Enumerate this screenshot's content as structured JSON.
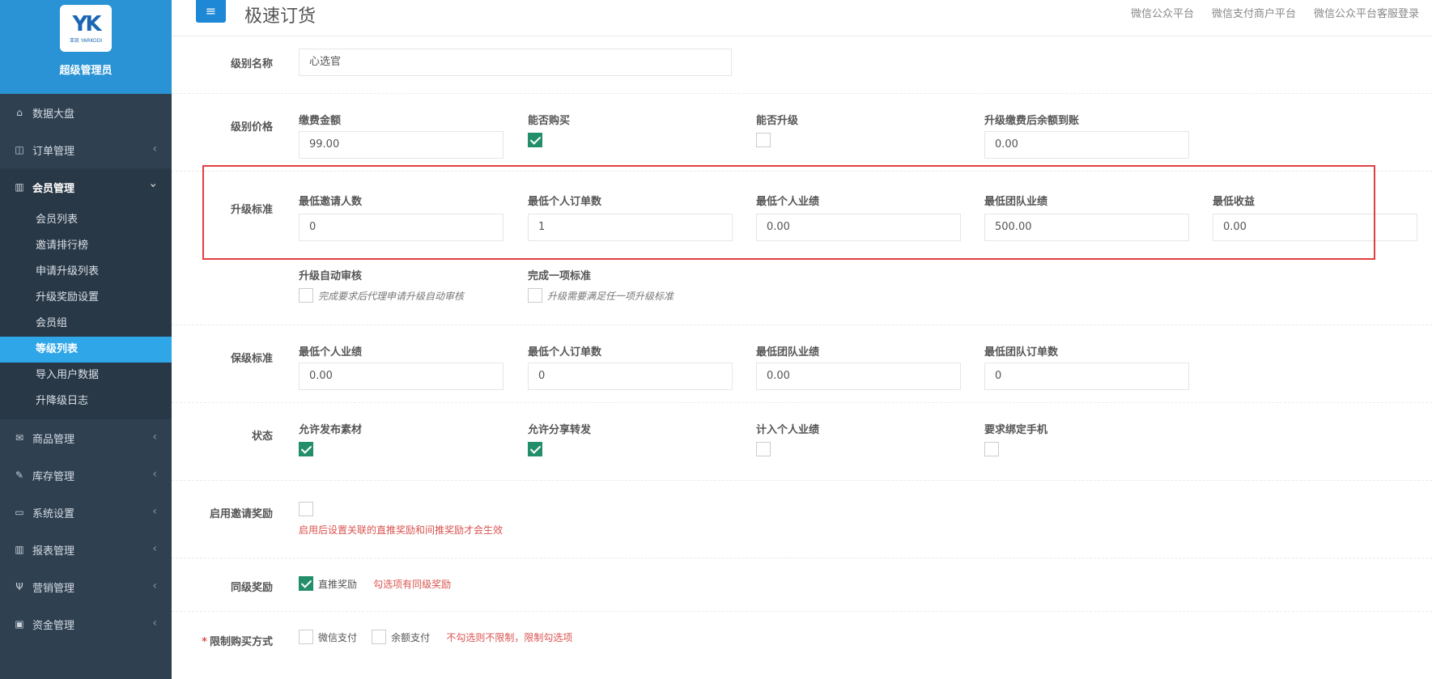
{
  "sidebar": {
    "brand_mark": "YK",
    "brand_sub": "亚凯 YARKODI",
    "brand_name": "超级管理员",
    "items": [
      {
        "label": "数据大盘",
        "icon": "home-icon"
      },
      {
        "label": "订单管理",
        "icon": "columns-icon"
      },
      {
        "label": "会员管理",
        "icon": "bar-chart-icon"
      },
      {
        "label": "商品管理",
        "icon": "envelope-icon"
      },
      {
        "label": "库存管理",
        "icon": "edit-icon"
      },
      {
        "label": "系统设置",
        "icon": "desktop-icon"
      },
      {
        "label": "报表管理",
        "icon": "bar-chart-icon"
      },
      {
        "label": "营销管理",
        "icon": "cutlery-icon"
      },
      {
        "label": "资金管理",
        "icon": "money-icon"
      }
    ],
    "submenu": [
      "会员列表",
      "邀请排行榜",
      "申请升级列表",
      "升级奖励设置",
      "会员组",
      "等级列表",
      "导入用户数据",
      "升降级日志"
    ]
  },
  "topbar": {
    "title": "极速订货",
    "links": [
      "微信公众平台",
      "微信支付商户平台",
      "微信公众平台客服登录"
    ]
  },
  "form": {
    "name_label": "级别名称",
    "name_value": "心选官",
    "price_label": "级别价格",
    "price": {
      "fee_label": "缴费金额",
      "fee_value": "99.00",
      "buy_label": "能否购买",
      "upgrade_label": "能否升级",
      "balance_label": "升级缴费后余额到账",
      "balance_value": "0.00"
    },
    "upgrade_label": "升级标准",
    "upgrade": [
      {
        "label": "最低邀请人数",
        "value": "0"
      },
      {
        "label": "最低个人订单数",
        "value": "1"
      },
      {
        "label": "最低个人业绩",
        "value": "0.00"
      },
      {
        "label": "最低团队业绩",
        "value": "500.00"
      },
      {
        "label": "最低收益",
        "value": "0.00"
      }
    ],
    "auto_audit_label": "升级自动审核",
    "auto_audit_note": "完成要求后代理申请升级自动审核",
    "one_standard_label": "完成一项标准",
    "one_standard_note": "升级需要满足任一项升级标准",
    "keep_label": "保级标准",
    "keep": [
      {
        "label": "最低个人业绩",
        "value": "0.00"
      },
      {
        "label": "最低个人订单数",
        "value": "0"
      },
      {
        "label": "最低团队业绩",
        "value": "0.00"
      },
      {
        "label": "最低团队订单数",
        "value": "0"
      }
    ],
    "status_label": "状态",
    "status": [
      {
        "label": "允许发布素材",
        "checked": true
      },
      {
        "label": "允许分享转发",
        "checked": true
      },
      {
        "label": "计入个人业绩",
        "checked": false
      },
      {
        "label": "要求绑定手机",
        "checked": false
      }
    ],
    "invite_label": "启用邀请奖励",
    "invite_note": "启用后设置关联的直推奖励和间推奖励才会生效",
    "same_label": "同级奖励",
    "same_option": "直推奖励",
    "same_note": "勾选项有同级奖励",
    "limit_label": "限制购买方式",
    "limit_required": "*",
    "limit_options": [
      "微信支付",
      "余额支付"
    ],
    "limit_note": "不勾选则不限制，限制勾选项"
  }
}
